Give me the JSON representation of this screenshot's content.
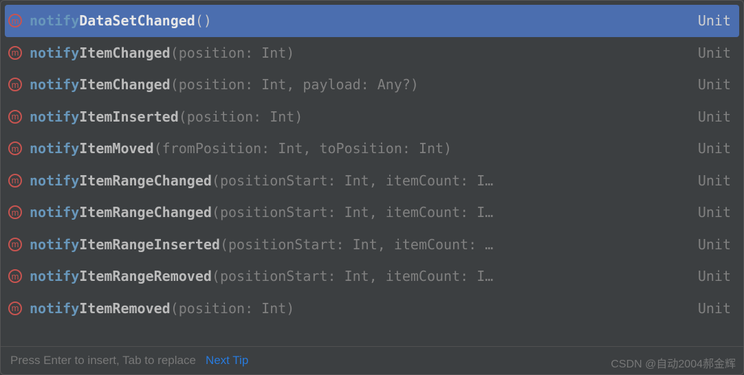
{
  "items": [
    {
      "prefix": "notify",
      "suffix": "DataSetChanged",
      "params": "()",
      "return": "Unit",
      "selected": true
    },
    {
      "prefix": "notify",
      "suffix": "ItemChanged",
      "params": "(position: Int)",
      "return": "Unit",
      "selected": false
    },
    {
      "prefix": "notify",
      "suffix": "ItemChanged",
      "params": "(position: Int, payload: Any?)",
      "return": "Unit",
      "selected": false
    },
    {
      "prefix": "notify",
      "suffix": "ItemInserted",
      "params": "(position: Int)",
      "return": "Unit",
      "selected": false
    },
    {
      "prefix": "notify",
      "suffix": "ItemMoved",
      "params": "(fromPosition: Int, toPosition: Int)",
      "return": "Unit",
      "selected": false
    },
    {
      "prefix": "notify",
      "suffix": "ItemRangeChanged",
      "params": "(positionStart: Int, itemCount: I…",
      "return": "Unit",
      "selected": false
    },
    {
      "prefix": "notify",
      "suffix": "ItemRangeChanged",
      "params": "(positionStart: Int, itemCount: I…",
      "return": "Unit",
      "selected": false
    },
    {
      "prefix": "notify",
      "suffix": "ItemRangeInserted",
      "params": "(positionStart: Int, itemCount: …",
      "return": "Unit",
      "selected": false
    },
    {
      "prefix": "notify",
      "suffix": "ItemRangeRemoved",
      "params": "(positionStart: Int, itemCount: I…",
      "return": "Unit",
      "selected": false
    },
    {
      "prefix": "notify",
      "suffix": "ItemRemoved",
      "params": "(position: Int)",
      "return": "Unit",
      "selected": false
    }
  ],
  "footer": {
    "hint": "Press Enter to insert, Tab to replace",
    "link": "Next Tip"
  },
  "icon_letter": "m",
  "watermark": "CSDN @自动2004郝金辉"
}
